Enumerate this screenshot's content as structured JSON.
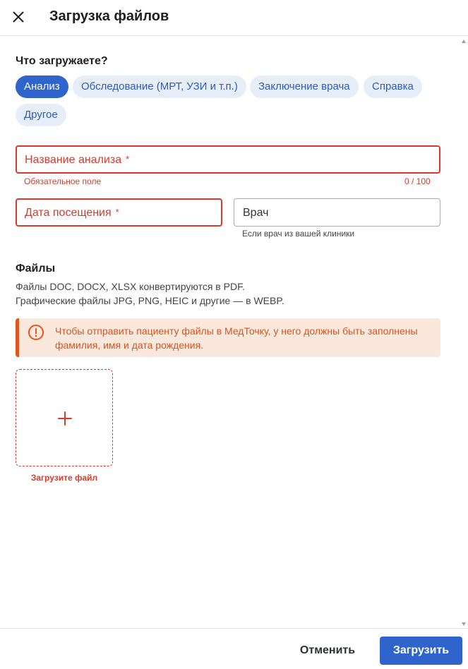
{
  "header": {
    "title": "Загрузка файлов",
    "close_icon": "close-icon"
  },
  "type_section": {
    "title": "Что загружаете?",
    "chips": [
      {
        "label": "Анализ",
        "selected": true
      },
      {
        "label": "Обследование (МРТ, УЗИ и т.п.)",
        "selected": false
      },
      {
        "label": "Заключение врача",
        "selected": false
      },
      {
        "label": "Справка",
        "selected": false
      },
      {
        "label": "Другое",
        "selected": false
      }
    ]
  },
  "form": {
    "analysis_name": {
      "label": "Название анализа",
      "required_mark": "*",
      "error": "Обязательное поле",
      "counter": "0 / 100"
    },
    "visit_date": {
      "label": "Дата посещения",
      "required_mark": "*"
    },
    "doctor": {
      "label": "Врач",
      "hint": "Если врач из вашей клиники"
    }
  },
  "files_section": {
    "title": "Файлы",
    "desc_line1": "Файлы DOC, DOCX, XLSX конвертируются в PDF.",
    "desc_line2": "Графические файлы JPG, PNG, HEIC и другие — в WEBP.",
    "alert": {
      "icon": "alert-circle-icon",
      "text": "Чтобы отправить пациенту файлы в МедТочку, у него должны быть заполнены фамилия, имя и дата рождения."
    },
    "upload": {
      "icon": "plus-icon",
      "label": "Загрузите файл"
    }
  },
  "footer": {
    "cancel_label": "Отменить",
    "submit_label": "Загрузить"
  },
  "colors": {
    "accent": "#2f64cc",
    "error": "#d93a2b",
    "warning_bg": "#fbe8dd",
    "warning_text": "#d9531b"
  }
}
